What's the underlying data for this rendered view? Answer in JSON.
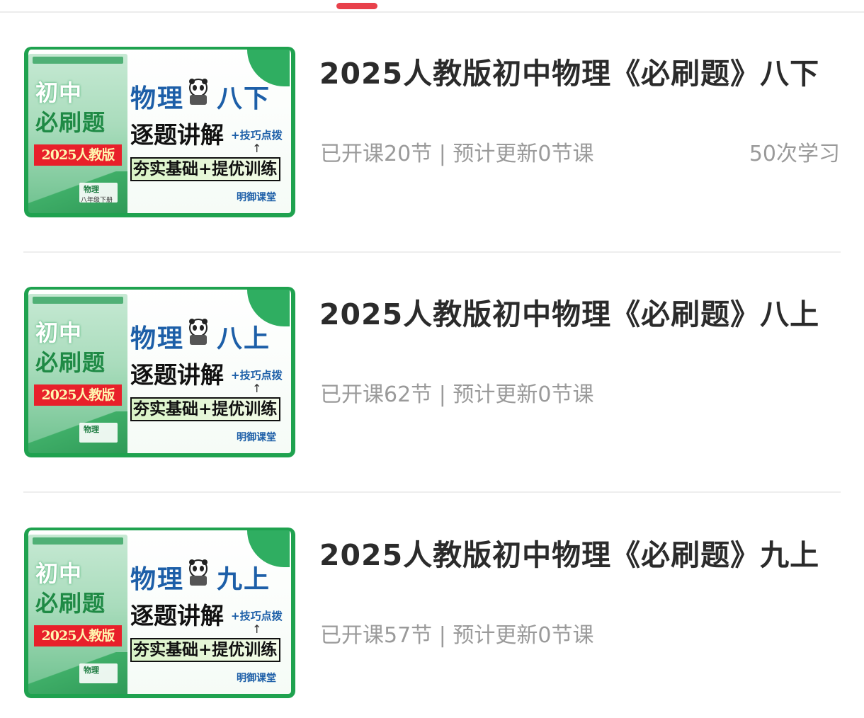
{
  "theme": {
    "accent": "#e8414b",
    "brand_green": "#1fa24f",
    "title_color": "#2b2b2b",
    "meta_color": "#9a9a9a"
  },
  "courses": [
    {
      "title": "2025人教版初中物理《必刷题》八下",
      "meta": "已开课20节 | 预计更新0节课",
      "study_count": "50次学习",
      "thumbnail": {
        "book_line1": "初中",
        "book_line2": "必刷题",
        "edition": "2025人教版",
        "subject_tag": "物理",
        "book_grade": "八年级下册",
        "subject": "物理",
        "grade": "八下",
        "slogan1": "逐题讲解",
        "slogan1_sub": "+技巧点拨",
        "slogan2": "夯实基础+提优训练",
        "publisher": "明御课堂"
      }
    },
    {
      "title": "2025人教版初中物理《必刷题》八上",
      "meta": "已开课62节 | 预计更新0节课",
      "study_count": "",
      "thumbnail": {
        "book_line1": "初中",
        "book_line2": "必刷题",
        "edition": "2025人教版",
        "subject_tag": "物理",
        "book_grade": "",
        "subject": "物理",
        "grade": "八上",
        "slogan1": "逐题讲解",
        "slogan1_sub": "+技巧点拨",
        "slogan2": "夯实基础+提优训练",
        "publisher": "明御课堂"
      }
    },
    {
      "title": "2025人教版初中物理《必刷题》九上",
      "meta": "已开课57节 | 预计更新0节课",
      "study_count": "",
      "thumbnail": {
        "book_line1": "初中",
        "book_line2": "必刷题",
        "edition": "2025人教版",
        "subject_tag": "物理",
        "book_grade": "",
        "subject": "物理",
        "grade": "九上",
        "slogan1": "逐题讲解",
        "slogan1_sub": "+技巧点拨",
        "slogan2": "夯实基础+提优训练",
        "publisher": "明御课堂"
      }
    }
  ]
}
